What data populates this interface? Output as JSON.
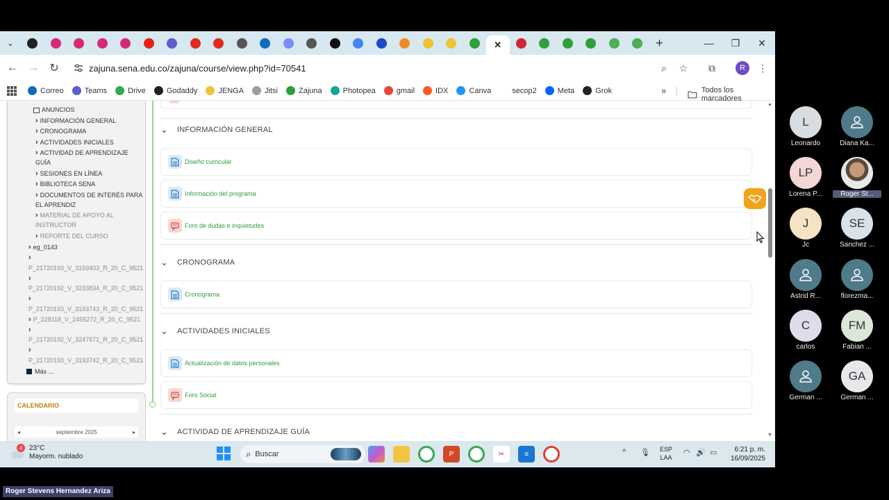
{
  "browser": {
    "url": "zajuna.sena.edu.co/zajuna/course/view.php?id=70541",
    "profile_initial": "R",
    "tabs": [
      {
        "icon": "circle-icon",
        "color": "#222222"
      },
      {
        "icon": "instagram-icon",
        "color": "#d62976"
      },
      {
        "icon": "instagram-icon",
        "color": "#d62976"
      },
      {
        "icon": "instagram-icon",
        "color": "#d62976"
      },
      {
        "icon": "instagram-icon",
        "color": "#d62976"
      },
      {
        "icon": "youtube-icon",
        "color": "#e62117"
      },
      {
        "icon": "teams-icon",
        "color": "#5b5fc7"
      },
      {
        "icon": "adobe-icon",
        "color": "#e02b20"
      },
      {
        "icon": "adobe-icon",
        "color": "#e02b20"
      },
      {
        "icon": "chrome-icon",
        "color": "#555555"
      },
      {
        "icon": "outlook-icon",
        "color": "#0f6cbd"
      },
      {
        "icon": "puzzle-icon",
        "color": "#7b8cff"
      },
      {
        "icon": "chrome-icon",
        "color": "#555555"
      },
      {
        "icon": "tiktok-icon",
        "color": "#111111"
      },
      {
        "icon": "google-icon",
        "color": "#4285f4"
      },
      {
        "icon": "shield-icon",
        "color": "#1a49c9"
      },
      {
        "icon": "fox-icon",
        "color": "#f08c1e"
      },
      {
        "icon": "sena-icon",
        "color": "#f1c232"
      },
      {
        "icon": "sena-icon",
        "color": "#f1c232"
      },
      {
        "icon": "zajuna-icon",
        "color": "#2e9f3a"
      },
      {
        "icon": "close-icon",
        "color": "#222222",
        "active": true
      },
      {
        "icon": "record-icon",
        "color": "#d0243a"
      },
      {
        "icon": "zajuna-icon",
        "color": "#2e9f3a"
      },
      {
        "icon": "zajuna-icon",
        "color": "#2e9f3a"
      },
      {
        "icon": "zajuna-icon",
        "color": "#2e9f3a"
      },
      {
        "icon": "star-icon",
        "color": "#4caf50"
      },
      {
        "icon": "star-icon",
        "color": "#4caf50"
      }
    ],
    "bookmarks": [
      {
        "label": "Correo",
        "icon": "outlook-icon",
        "color": "#0f6cbd"
      },
      {
        "label": "Teams",
        "icon": "teams-icon",
        "color": "#5b5fc7"
      },
      {
        "label": "Drive",
        "icon": "drive-icon",
        "color": "#34a853"
      },
      {
        "label": "Godaddy",
        "icon": "godaddy-icon",
        "color": "#222222"
      },
      {
        "label": "JENGA",
        "icon": "crown-icon",
        "color": "#f1c232"
      },
      {
        "label": "Jitsi",
        "icon": "jitsi-icon",
        "color": "#9e9e9e"
      },
      {
        "label": "Zajuna",
        "icon": "zajuna-icon",
        "color": "#2e9f3a"
      },
      {
        "label": "Photopea",
        "icon": "photopea-icon",
        "color": "#18a497"
      },
      {
        "label": "gmail",
        "icon": "gmail-icon",
        "color": "#ea4335"
      },
      {
        "label": "IDX",
        "icon": "idx-icon",
        "color": "#ff5722"
      },
      {
        "label": "Canva",
        "icon": "canva-icon",
        "color": "#2196f3"
      },
      {
        "label": "secop2",
        "icon": "",
        "color": "#ffffff"
      },
      {
        "label": "Meta",
        "icon": "meta-icon",
        "color": "#0866ff"
      },
      {
        "label": "Grok",
        "icon": "grok-icon",
        "color": "#222222"
      }
    ],
    "more_bookmarks": "»",
    "all_bookmarks_label": "Todos los marcadores"
  },
  "sidebar": {
    "items": [
      {
        "label": "ANUNCIOS",
        "chevron": false,
        "icon": true,
        "muted": false
      },
      {
        "label": "INFORMACIÓN GENERAL",
        "chevron": true,
        "muted": false
      },
      {
        "label": "CRONOGRAMA",
        "chevron": true,
        "muted": false
      },
      {
        "label": "ACTIVIDADES INICIALES",
        "chevron": true,
        "muted": false
      },
      {
        "label": "ACTIVIDAD DE APRENDIZAJE",
        "label2": "GUÍA",
        "chevron": true,
        "muted": false
      },
      {
        "label": "SESIONES EN LÍNEA",
        "chevron": true,
        "muted": false
      },
      {
        "label": "BIBLIOTECA SENA",
        "chevron": true,
        "muted": false
      },
      {
        "label": "DOCUMENTOS DE INTERÉS PARA",
        "label2": "EL APRENDIZ",
        "chevron": true,
        "muted": false
      },
      {
        "label": "MATERIAL DE APOYO AL",
        "label2": "INSTRUCTOR",
        "chevron": true,
        "muted": true
      },
      {
        "label": "REPORTE DEL CURSO",
        "chevron": true,
        "muted": true
      }
    ],
    "courses": [
      {
        "label": "eg_0143"
      },
      {
        "label": "P_21720193_V_3159403_R_20_C_9521"
      },
      {
        "label": "P_21720192_V_3233834_R_20_C_9521"
      },
      {
        "label": "P_21720193_V_3193743_R_20_C_9521",
        "inline": "P_228118_V_2455272_R_20_C_9521"
      },
      {
        "label": "P_21720192_V_3247671_R_20_C_9521"
      },
      {
        "label": "P_21720193_V_3193742_R_20_C_9521"
      }
    ],
    "more": "Más ...",
    "calendar_title": "CALENDARIO",
    "calendar_month": "septiembre 2025",
    "calendar_prev": "◂",
    "calendar_next": "▸"
  },
  "main": {
    "sections": [
      {
        "title": "INFORMACIÓN GENERAL",
        "activities": [
          {
            "label": "Diseño curricular",
            "type": "doc"
          },
          {
            "label": "Información del programa",
            "type": "doc"
          },
          {
            "label": "Foro de dudas e inquietudes",
            "type": "forum"
          }
        ]
      },
      {
        "title": "CRONOGRAMA",
        "activities": [
          {
            "label": "Cronograma",
            "type": "doc"
          }
        ]
      },
      {
        "title": "ACTIVIDADES INICIALES",
        "activities": [
          {
            "label": "Actualización de datos personales",
            "type": "doc"
          },
          {
            "label": "Foro Social",
            "type": "forum"
          }
        ]
      },
      {
        "title": "ACTIVIDAD DE APRENDIZAJE GUÍA",
        "activities": []
      }
    ]
  },
  "taskbar": {
    "weather_badge": "4",
    "temperature": "23°C",
    "weather_desc": "Mayorm. nublado",
    "search_placeholder": "Buscar",
    "lang_line1": "ESP",
    "lang_line2": "LAA",
    "time": "6:21 p. m.",
    "date": "16/09/2025"
  },
  "meeting": {
    "participants": [
      {
        "initials": "L",
        "name": "Leonardo",
        "bg": "#d8dde2",
        "fg": "#333333",
        "icon": false
      },
      {
        "initials": "",
        "name": "Diana Ka...",
        "bg": "#4f7a8a",
        "fg": "#ffffff",
        "icon": true
      },
      {
        "initials": "LP",
        "name": "Lorena P...",
        "bg": "#f3d6d6",
        "fg": "#333333",
        "icon": false
      },
      {
        "initials": "",
        "name": "Roger St...",
        "bg": "#c8c8c8",
        "fg": "#333333",
        "icon": false,
        "photo": true,
        "highlight": true
      },
      {
        "initials": "J",
        "name": "Jc",
        "bg": "#f6e3c6",
        "fg": "#333333",
        "icon": false
      },
      {
        "initials": "SE",
        "name": "Sanchez ...",
        "bg": "#d8e2e8",
        "fg": "#333333",
        "icon": false
      },
      {
        "initials": "",
        "name": "Astrid R...",
        "bg": "#4f7a8a",
        "fg": "#ffffff",
        "icon": true
      },
      {
        "initials": "",
        "name": "florezma...",
        "bg": "#4f7a8a",
        "fg": "#ffffff",
        "icon": true
      },
      {
        "initials": "C",
        "name": "carlos",
        "bg": "#dcdde8",
        "fg": "#333333",
        "icon": false
      },
      {
        "initials": "FM",
        "name": "Fabian ...",
        "bg": "#dbe8d8",
        "fg": "#333333",
        "icon": false
      },
      {
        "initials": "",
        "name": "German ...",
        "bg": "#4f7a8a",
        "fg": "#ffffff",
        "icon": true
      },
      {
        "initials": "GA",
        "name": "German ...",
        "bg": "#e6e8ec",
        "fg": "#333333",
        "icon": false
      }
    ],
    "self_label": "Roger Stevens Hernandez Ariza"
  }
}
